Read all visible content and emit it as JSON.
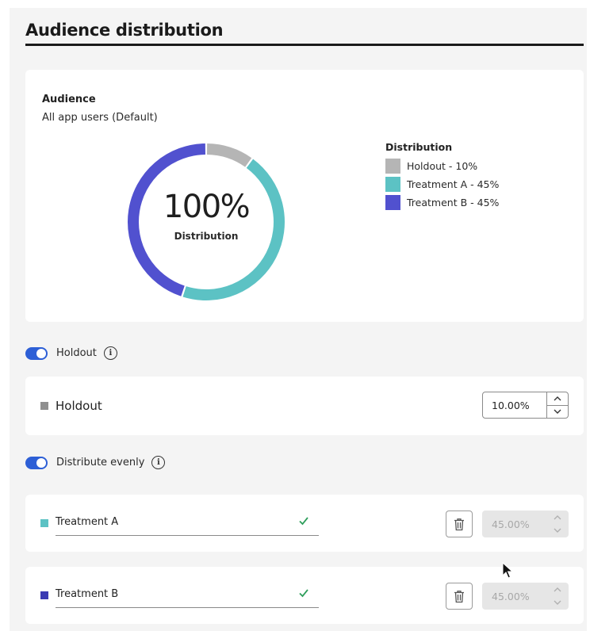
{
  "title": "Audience distribution",
  "audience": {
    "label": "Audience",
    "value": "All app users (Default)"
  },
  "donut": {
    "center_value": "100%",
    "center_label": "Distribution"
  },
  "legend": {
    "title": "Distribution",
    "items": [
      {
        "label": "Holdout - 10%",
        "color": "#b5b5b5"
      },
      {
        "label": "Treatment A - 45%",
        "color": "#5cc2c4"
      },
      {
        "label": "Treatment B - 45%",
        "color": "#5151cf"
      }
    ]
  },
  "chart_data": {
    "type": "pie",
    "categories": [
      "Holdout",
      "Treatment A",
      "Treatment B"
    ],
    "values": [
      10,
      45,
      45
    ],
    "colors": [
      "#b5b5b5",
      "#5cc2c4",
      "#5151cf"
    ],
    "donut": true
  },
  "holdout_toggle": {
    "label": "Holdout",
    "on": true
  },
  "holdout_row": {
    "label": "Holdout",
    "value": "10.00%",
    "color": "#8f8f8f"
  },
  "distribute_toggle": {
    "label": "Distribute evenly",
    "on": true
  },
  "treatments": [
    {
      "name": "Treatment A",
      "value": "45.00%",
      "color": "#5cc2c4"
    },
    {
      "name": "Treatment B",
      "value": "45.00%",
      "color": "#3b3bb3"
    }
  ],
  "icons": {
    "info": "info-icon",
    "check": "checkmark-icon",
    "delete": "trash-icon",
    "up": "chevron-up-icon",
    "down": "chevron-down-icon"
  }
}
